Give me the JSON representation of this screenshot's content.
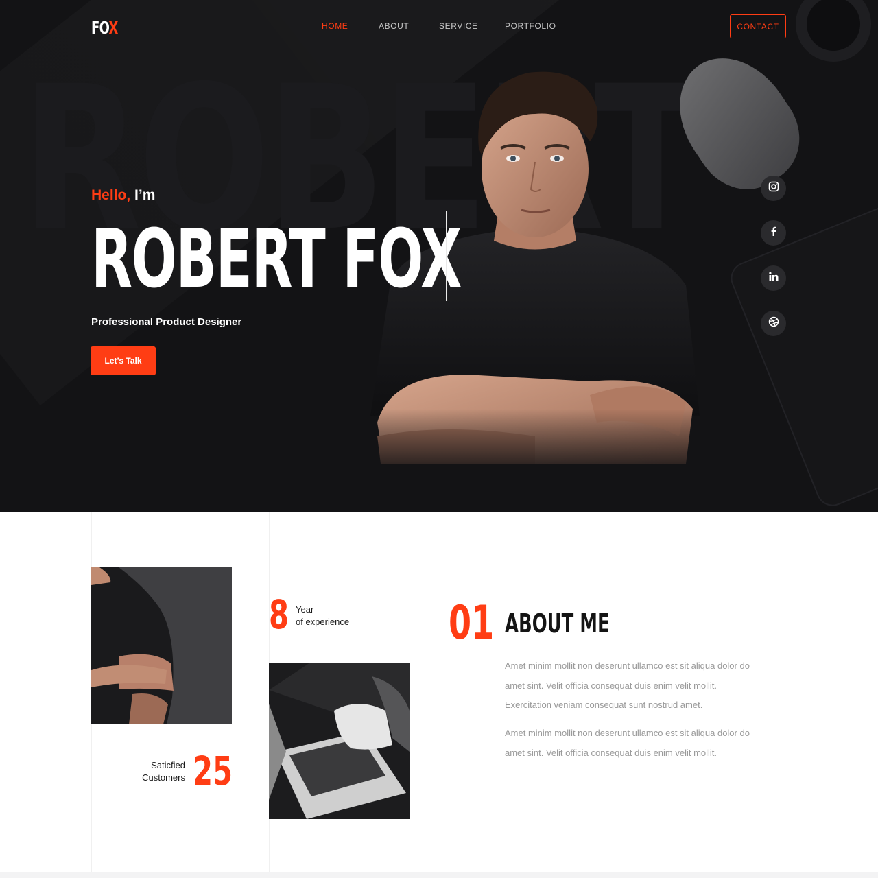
{
  "brand": {
    "logo_part1": "FO",
    "logo_part2": "X",
    "accent_color": "#ff3d14",
    "hero_bg_color": "#131315"
  },
  "nav": {
    "items": [
      {
        "label": "HOME",
        "active": true
      },
      {
        "label": "ABOUT",
        "active": false
      },
      {
        "label": "SERVICE",
        "active": false
      },
      {
        "label": "PORTFOLIO",
        "active": false
      }
    ],
    "contact_label": "CONTACT"
  },
  "hero": {
    "watermark": "ROBERT FOX",
    "greeting_accent": "Hello,",
    "greeting_rest": "I’m",
    "name": "ROBERT FOX",
    "subtitle": "Professional Product Designer",
    "cta_label": "Let’s Talk"
  },
  "social": [
    {
      "icon": "instagram-icon"
    },
    {
      "icon": "facebook-icon"
    },
    {
      "icon": "linkedin-icon"
    },
    {
      "icon": "dribbble-icon"
    }
  ],
  "stats": {
    "experience_value": "8",
    "experience_line1": "Year",
    "experience_line2": "of experience",
    "customers_value": "25",
    "customers_line1": "Saticfied",
    "customers_line2": "Customers"
  },
  "about": {
    "number": "01",
    "title": "ABOUT ME",
    "paragraph1": "Amet minim mollit non deserunt ullamco est sit aliqua dolor do amet sint. Velit officia consequat duis enim velit mollit. Exercitation veniam consequat sunt nostrud amet.",
    "paragraph2": "Amet minim mollit non deserunt ullamco est sit aliqua dolor do amet sint. Velit officia consequat duis enim velit mollit."
  }
}
